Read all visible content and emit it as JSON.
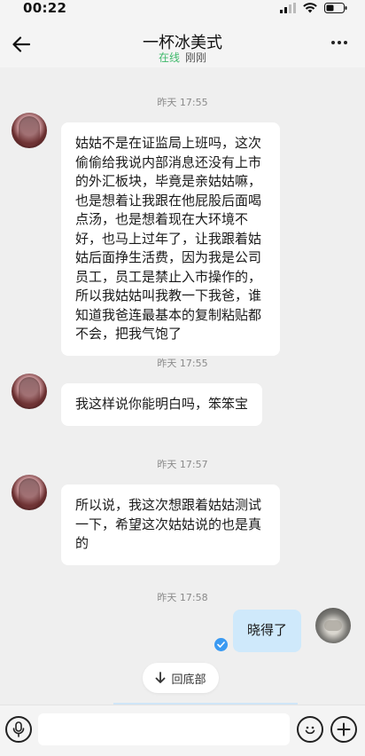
{
  "status_bar": {
    "time": "00:22"
  },
  "header": {
    "title": "一杯冰美式",
    "status_online": "在线",
    "status_last_seen": "刚刚"
  },
  "messages": [
    {
      "timestamp": "昨天 17:55",
      "side": "left",
      "text": "姑姑不是在证监局上班吗，这次偷偷给我说内部消息还没有上市的外汇板块，毕竟是亲姑姑嘛，也是想着让我跟在他屁股后面喝点汤，也是想着现在大环境不好，也马上过年了，让我跟着姑姑后面挣生活费，因为我是公司员工，员工是禁止入市操作的，所以我姑姑叫我教一下我爸，谁知道我爸连最基本的复制粘贴都不会，把我气饱了"
    },
    {
      "timestamp": "昨天 17:55",
      "side": "left",
      "text": "我这样说你能明白吗，笨笨宝"
    },
    {
      "timestamp": "昨天 17:57",
      "side": "left",
      "text": "所以说，我这次想跟着姑姑测试一下，希望这次姑姑说的也是真的"
    },
    {
      "timestamp": "昨天 17:58",
      "side": "right",
      "text": "晓得了"
    }
  ],
  "scroll_to_bottom_label": "回底部",
  "input": {
    "placeholder": ""
  },
  "icons": {
    "back": "arrow-left-icon",
    "more": "more-dots-icon",
    "voice": "microphone-icon",
    "emoji": "smiley-icon",
    "plus": "plus-icon",
    "read": "check-icon"
  },
  "colors": {
    "online": "#3fb96b",
    "right_bubble": "#cfe9fb",
    "read_check": "#3a9af2"
  }
}
